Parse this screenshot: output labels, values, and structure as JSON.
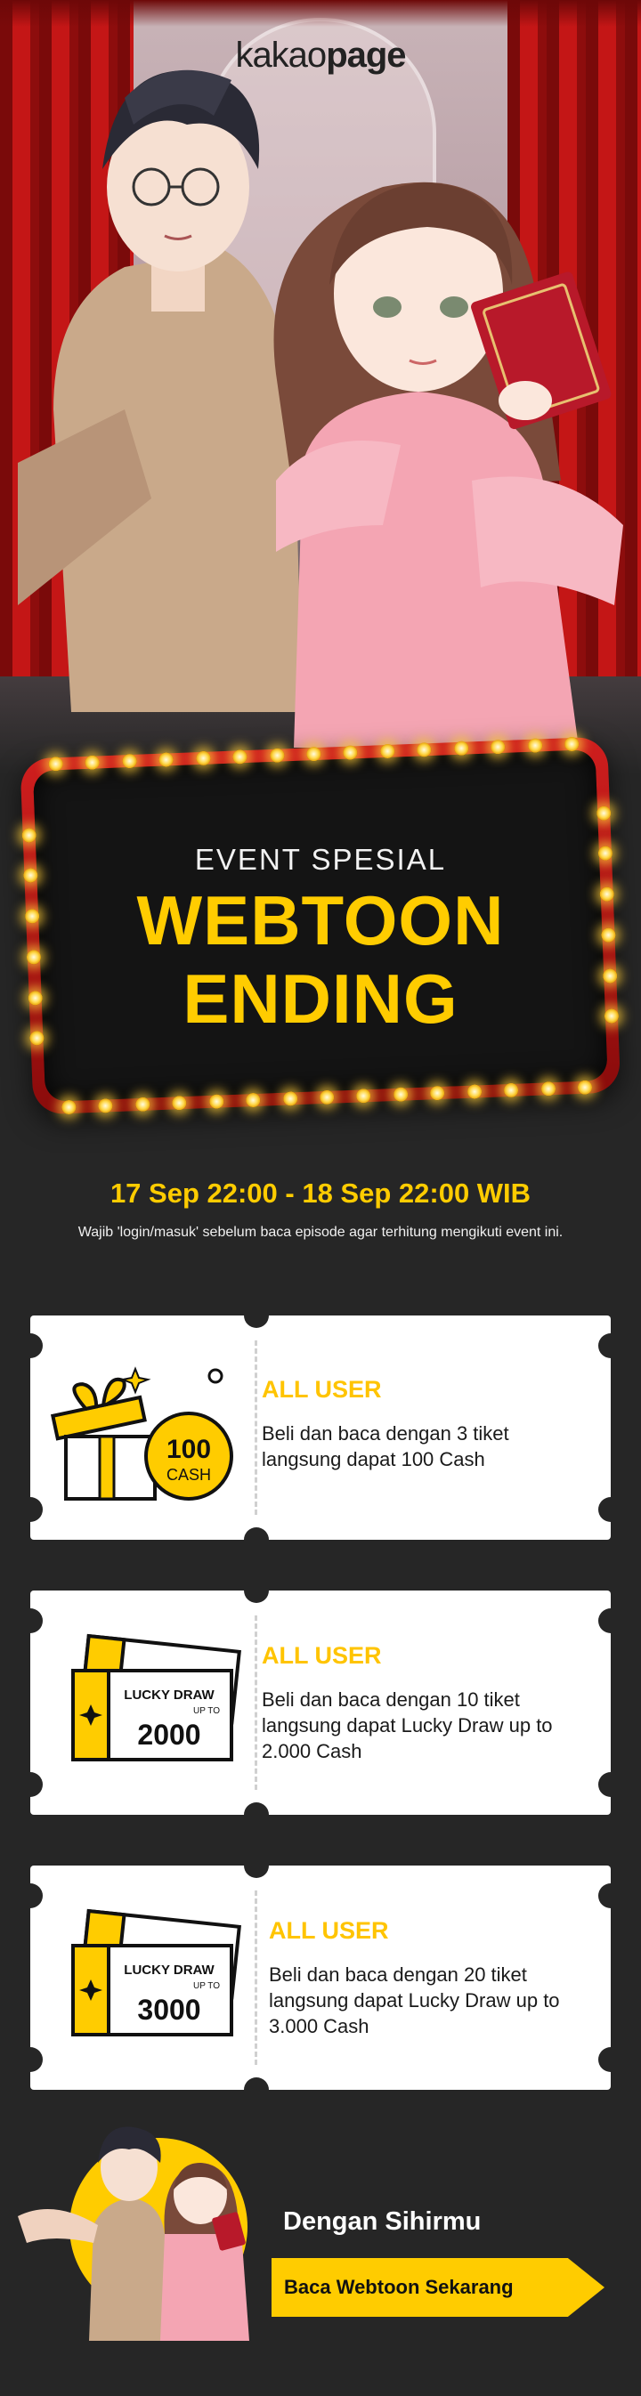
{
  "brand": {
    "logo_light": "kakao",
    "logo_bold": "page"
  },
  "event": {
    "label": "EVENT SPESIAL",
    "title_line1": "WEBTOON",
    "title_line2": "ENDING"
  },
  "period": {
    "dates": "17 Sep 22:00 - 18 Sep 22:00 WIB",
    "note": "Wajib 'login/masuk' sebelum baca episode agar terhitung mengikuti event ini."
  },
  "rewards": [
    {
      "title": "ALL USER",
      "desc": "Beli dan baca dengan 3 tiket langsung dapat 100 Cash",
      "badge_top": "100",
      "badge_bottom": "CASH",
      "icon": "gift-box-icon"
    },
    {
      "title": "ALL USER",
      "desc": "Beli dan baca dengan 10 tiket langsung dapat Lucky Draw up to 2.000 Cash",
      "ticket_label": "LUCKY DRAW",
      "ticket_upto": "UP TO",
      "ticket_amount": "2000",
      "icon": "lucky-draw-ticket-icon"
    },
    {
      "title": "ALL USER",
      "desc": "Beli dan baca dengan 20 tiket langsung dapat Lucky Draw up to 3.000 Cash",
      "ticket_label": "LUCKY DRAW",
      "ticket_upto": "UP TO",
      "ticket_amount": "3000",
      "icon": "lucky-draw-ticket-icon"
    }
  ],
  "cta": {
    "title": "Dengan Sihirmu",
    "button_label": "Baca Webtoon Sekarang"
  },
  "colors": {
    "accent": "#ffcc00",
    "background": "#262626",
    "curtain": "#c41616"
  }
}
